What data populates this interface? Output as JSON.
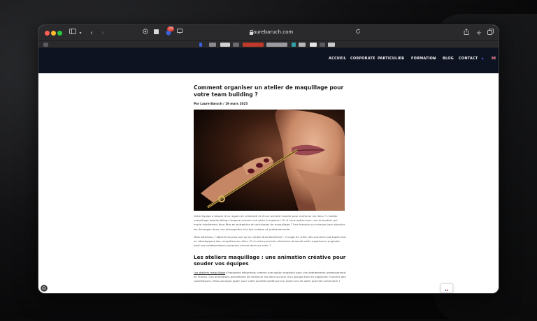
{
  "browser": {
    "url": "laurebaruch.com",
    "tab_badge": "23"
  },
  "site_nav": {
    "items": [
      "ACCUEIL",
      "CORPORATE",
      "PARTICULIER",
      "FORMATION",
      "BLOG",
      "CONTACT"
    ]
  },
  "article": {
    "title": "Comment organiser un atelier de maquillage pour votre team building ?",
    "meta": "Par Laure Baruch / 19 mars 2025",
    "image_alt": "Maquilleuse appliquant un rouge à lèvres au pinceau",
    "paragraph_1": "Votre équipe a besoin d'un regain de créativité et d'une activité insolite pour renforcer les liens ? L'atelier maquillage teambuilding s'impose comme une piste à explorer ! Et si vous optiez pour une animation qui marie habilement bien-être en entreprise et techniques de maquillage ? Une formule sur mesure pour stimuler les échanges dans une atmosphère à la fois ludique et professionnelle.",
    "paragraph_2": "Mais attention, l'objectif va plus loin qu'un simple divertissement : il s'agit de créer des souvenirs partagés tout en développant des compétences utiles. Et si votre prochain séminaire devenait cette expérience originale dont vos collaborateurs parleront encore dans six mois ?",
    "heading_2": "Les ateliers maquillage : une animation créative pour souder vos équipes",
    "paragraph_3_link": "Les ateliers maquillage",
    "paragraph_3": " s'imposent désormais comme une option originale pour vos événements professionnels en France. Ces animations permettent de renforcer les liens au sein d'un groupe tout en explorant l'univers des cosmétiques. Mais pourquoi opter pour cette activité plutôt qu'une autre lors de votre prochain séminaire ?"
  },
  "colors": {
    "nav_bg": "#0e1322",
    "toolbar_bg": "#2a2a2c",
    "badge": "#e0453a"
  }
}
